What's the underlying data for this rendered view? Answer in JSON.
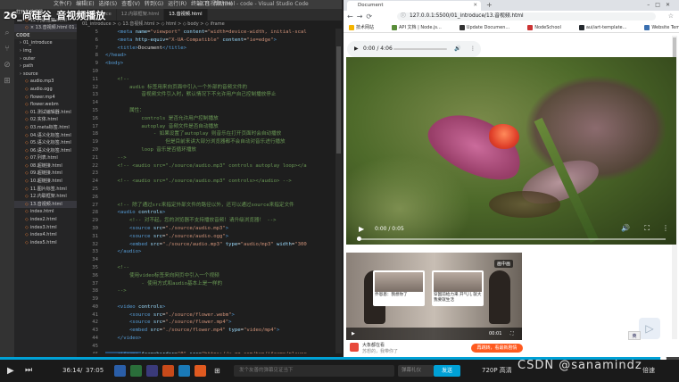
{
  "course_title": "26_尚硅谷_音视频播放",
  "vscode": {
    "title_menus": [
      "文件(F)",
      "编辑(E)",
      "选择(S)",
      "查看(V)",
      "转到(G)",
      "运行(R)",
      "终端(T)",
      "帮助(H)"
    ],
    "window_title": "13.音视频.html - code - Visual Studio Code",
    "activity_icons": [
      "files-icon",
      "search-icon",
      "git-icon",
      "debug-icon",
      "extensions-icon"
    ],
    "explorer": [
      {
        "label": "打开的编辑器",
        "type": "section"
      },
      {
        "label": "12.内联框架.html",
        "type": "file"
      },
      {
        "label": "× 13.音视频.html 01...",
        "type": "file",
        "selected": true
      },
      {
        "label": "CODE",
        "type": "section"
      },
      {
        "label": "01_introduce",
        "type": "folder"
      },
      {
        "label": "img",
        "type": "folder"
      },
      {
        "label": "outer",
        "type": "folder"
      },
      {
        "label": "path",
        "type": "folder"
      },
      {
        "label": "source",
        "type": "folder"
      },
      {
        "label": "audio.mp3",
        "type": "file"
      },
      {
        "label": "audio.ogg",
        "type": "file"
      },
      {
        "label": "flower.mp4",
        "type": "file"
      },
      {
        "label": "flower.webm",
        "type": "file"
      },
      {
        "label": "01.测试编辑器.html",
        "type": "file"
      },
      {
        "label": "02.实体.html",
        "type": "file"
      },
      {
        "label": "03.meta标签.html",
        "type": "file"
      },
      {
        "label": "04.语义化标签.html",
        "type": "file"
      },
      {
        "label": "05.语义化标签.html",
        "type": "file"
      },
      {
        "label": "06.语义化标签.html",
        "type": "file"
      },
      {
        "label": "07.列表.html",
        "type": "file"
      },
      {
        "label": "08.超链接.html",
        "type": "file"
      },
      {
        "label": "09.超链接.html",
        "type": "file"
      },
      {
        "label": "10.超链接.html",
        "type": "file"
      },
      {
        "label": "11.图片标签.html",
        "type": "file"
      },
      {
        "label": "12.内联框架.html",
        "type": "file"
      },
      {
        "label": "13.音视频.html",
        "type": "file",
        "selected": true
      },
      {
        "label": "index.html",
        "type": "file"
      },
      {
        "label": "index2.html",
        "type": "file"
      },
      {
        "label": "index3.html",
        "type": "file"
      },
      {
        "label": "index4.html",
        "type": "file"
      },
      {
        "label": "index5.html",
        "type": "file"
      }
    ],
    "tabs": [
      "01_introduce",
      "12.内联框架.html",
      "13.音视频.html"
    ],
    "breadcrumb": "01_introduce > ◇ 13.音视频.html > ◇ html > ◇ body > ◇ iframe",
    "lines": [
      {
        "n": "5",
        "seg": [
          [
            "tag",
            "    <meta "
          ],
          [
            "attr",
            "name"
          ],
          [
            "txt",
            "="
          ],
          [
            "str",
            "\"viewport\""
          ],
          [
            "txt",
            " "
          ],
          [
            "attr",
            "content"
          ],
          [
            "txt",
            "="
          ],
          [
            "str",
            "\"width=device-width, initial-scal"
          ]
        ]
      },
      {
        "n": "6",
        "seg": [
          [
            "tag",
            "    <meta "
          ],
          [
            "attr",
            "http-equiv"
          ],
          [
            "txt",
            "="
          ],
          [
            "str",
            "\"X-UA-Compatible\""
          ],
          [
            "txt",
            " "
          ],
          [
            "attr",
            "content"
          ],
          [
            "txt",
            "="
          ],
          [
            "str",
            "\"ie=edge\""
          ],
          [
            "tag",
            ">"
          ]
        ]
      },
      {
        "n": "7",
        "seg": [
          [
            "tag",
            "    <title>"
          ],
          [
            "txt",
            "Document"
          ],
          [
            "tag",
            "</title>"
          ]
        ]
      },
      {
        "n": "8",
        "seg": [
          [
            "tag",
            "</head>"
          ]
        ]
      },
      {
        "n": "9",
        "seg": [
          [
            "tag",
            "<body>"
          ]
        ]
      },
      {
        "n": "10",
        "seg": [
          [
            "txt",
            ""
          ]
        ]
      },
      {
        "n": "11",
        "seg": [
          [
            "com",
            "    <!--"
          ]
        ]
      },
      {
        "n": "12",
        "seg": [
          [
            "com",
            "        audio 标签用来向页面中引入一个外部的音频文件的"
          ]
        ]
      },
      {
        "n": "13",
        "seg": [
          [
            "com",
            "            音视频文件引入时，默认情况下不允许用户自己控制播放停止"
          ]
        ]
      },
      {
        "n": "14",
        "seg": [
          [
            "txt",
            ""
          ]
        ]
      },
      {
        "n": "15",
        "seg": [
          [
            "com",
            "        属性："
          ]
        ]
      },
      {
        "n": "16",
        "seg": [
          [
            "com",
            "            controls 是否允许用户控制播放"
          ]
        ]
      },
      {
        "n": "17",
        "seg": [
          [
            "com",
            "            autoplay 音频文件是否自动播放"
          ]
        ]
      },
      {
        "n": "18",
        "seg": [
          [
            "com",
            "                - 如果设置了autoplay 则音乐在打开页面时会自动播放"
          ]
        ]
      },
      {
        "n": "19",
        "seg": [
          [
            "com",
            "                    但是目前来讲大部分浏览器都不会自动对音乐进行播放"
          ]
        ]
      },
      {
        "n": "20",
        "seg": [
          [
            "com",
            "            loop 音乐是否循环播放"
          ]
        ]
      },
      {
        "n": "21",
        "seg": [
          [
            "com",
            "    -->"
          ]
        ]
      },
      {
        "n": "22",
        "seg": [
          [
            "com",
            "    <!-- <audio src=\"./source/audio.mp3\" controls autoplay loop></a"
          ]
        ]
      },
      {
        "n": "23",
        "seg": [
          [
            "txt",
            ""
          ]
        ]
      },
      {
        "n": "24",
        "seg": [
          [
            "com",
            "    <!-- <audio src=\"./source/audio.mp3\" controls></audio> -->"
          ]
        ]
      },
      {
        "n": "25",
        "seg": [
          [
            "txt",
            ""
          ]
        ]
      },
      {
        "n": "26",
        "seg": [
          [
            "txt",
            ""
          ]
        ]
      },
      {
        "n": "27",
        "seg": [
          [
            "com",
            "    <!-- 除了通过src来指定外部文件的路径以外，还可以通过source来指定文件"
          ]
        ]
      },
      {
        "n": "28",
        "seg": [
          [
            "tag",
            "    <audio "
          ],
          [
            "attr",
            "controls"
          ],
          [
            "tag",
            ">"
          ]
        ]
      },
      {
        "n": "29",
        "seg": [
          [
            "com",
            "        <!-- 对不起，您的浏览器不支持播放音频！请升级浏览器！ -->"
          ]
        ]
      },
      {
        "n": "30",
        "seg": [
          [
            "tag",
            "        <source "
          ],
          [
            "attr",
            "src"
          ],
          [
            "txt",
            "="
          ],
          [
            "str",
            "\"./source/audio.mp3\""
          ],
          [
            "tag",
            ">"
          ]
        ]
      },
      {
        "n": "31",
        "seg": [
          [
            "tag",
            "        <source "
          ],
          [
            "attr",
            "src"
          ],
          [
            "txt",
            "="
          ],
          [
            "str",
            "\"./source/audio.ogg\""
          ],
          [
            "tag",
            ">"
          ]
        ]
      },
      {
        "n": "32",
        "seg": [
          [
            "tag",
            "        <embed "
          ],
          [
            "attr",
            "src"
          ],
          [
            "txt",
            "="
          ],
          [
            "str",
            "\"./source/audio.mp3\""
          ],
          [
            "txt",
            " "
          ],
          [
            "attr",
            "type"
          ],
          [
            "txt",
            "="
          ],
          [
            "str",
            "\"audio/mp3\""
          ],
          [
            "txt",
            " "
          ],
          [
            "attr",
            "width"
          ],
          [
            "txt",
            "="
          ],
          [
            "str",
            "\"300"
          ]
        ]
      },
      {
        "n": "33",
        "seg": [
          [
            "tag",
            "    </audio>"
          ]
        ]
      },
      {
        "n": "34",
        "seg": [
          [
            "txt",
            ""
          ]
        ]
      },
      {
        "n": "35",
        "seg": [
          [
            "com",
            "    <!--"
          ]
        ]
      },
      {
        "n": "36",
        "seg": [
          [
            "com",
            "        使用video标签来向网页中引入一个视频"
          ]
        ]
      },
      {
        "n": "37",
        "seg": [
          [
            "com",
            "            - 使用方式和audio基本上是一样的"
          ]
        ]
      },
      {
        "n": "38",
        "seg": [
          [
            "com",
            "    -->"
          ]
        ]
      },
      {
        "n": "39",
        "seg": [
          [
            "txt",
            ""
          ]
        ]
      },
      {
        "n": "40",
        "seg": [
          [
            "tag",
            "    <video "
          ],
          [
            "attr",
            "controls"
          ],
          [
            "tag",
            ">"
          ]
        ]
      },
      {
        "n": "41",
        "seg": [
          [
            "tag",
            "        <source "
          ],
          [
            "attr",
            "src"
          ],
          [
            "txt",
            "="
          ],
          [
            "str",
            "\"./source/flower.webm\""
          ],
          [
            "tag",
            ">"
          ]
        ]
      },
      {
        "n": "42",
        "seg": [
          [
            "tag",
            "        <source "
          ],
          [
            "attr",
            "src"
          ],
          [
            "txt",
            "="
          ],
          [
            "str",
            "\"./source/flower.mp4\""
          ],
          [
            "tag",
            ">"
          ]
        ]
      },
      {
        "n": "43",
        "seg": [
          [
            "tag",
            "        <embed "
          ],
          [
            "attr",
            "src"
          ],
          [
            "txt",
            "="
          ],
          [
            "str",
            "\"./source/flower.mp4\""
          ],
          [
            "txt",
            " "
          ],
          [
            "attr",
            "type"
          ],
          [
            "txt",
            "="
          ],
          [
            "str",
            "\"video/mp4\""
          ],
          [
            "tag",
            ">"
          ]
        ]
      },
      {
        "n": "44",
        "seg": [
          [
            "tag",
            "    </video>"
          ]
        ]
      },
      {
        "n": "45",
        "seg": [
          [
            "txt",
            ""
          ]
        ]
      },
      {
        "n": "46",
        "seg": [
          [
            "tag",
            "    <iframe "
          ],
          [
            "attr",
            "frameborder"
          ],
          [
            "txt",
            "="
          ],
          [
            "str",
            "\"0\""
          ],
          [
            "txt",
            " "
          ],
          [
            "attr",
            "src"
          ],
          [
            "txt",
            "="
          ],
          [
            "str",
            "\"https://v.qq.com/txp/iframe/player"
          ]
        ]
      },
      {
        "n": "47",
        "seg": [
          [
            "tag",
            "</body>"
          ]
        ]
      }
    ],
    "status_items": [
      "行 46，列 13 (已选择 6)",
      "空格: 4",
      "UTF-8",
      "CRLF",
      "HTML",
      "Port : 5500",
      "☺",
      "🔔"
    ]
  },
  "browser": {
    "tab_title": "Document",
    "url": "127.0.0.1:5500/01_introduce/13.音视频.html",
    "bookmarks": [
      {
        "label": "技术网站",
        "color": "#f5b400"
      },
      {
        "label": "API 文档 | Node.js...",
        "color": "#5a8e3a"
      },
      {
        "label": "Update Documen...",
        "color": "#333333"
      },
      {
        "label": "NodeSchool",
        "color": "#cc3333"
      },
      {
        "label": "aui/art-template...",
        "color": "#24292e"
      },
      {
        "label": "Website Template...",
        "color": "#3a6fb0"
      }
    ],
    "audio": {
      "play": "▶",
      "time": "0:00 / 4:06",
      "volume_icon": "🔊",
      "more_icon": "⋮"
    },
    "video": {
      "time": "0:00 / 0:05",
      "progress": 0
    },
    "iframe": {
      "pip": "画中画",
      "card1": "乔恩恩：我想你了",
      "card2": "穿国前给力来 开气儿 就大我要就生活",
      "time": "00:01"
    },
    "ad": {
      "title": "大象都在看",
      "sub": "苏想的，我带你了",
      "button": "再跳转，看最新剧情"
    },
    "ime": "英"
  },
  "player": {
    "current": "36:14",
    "total": "37:05",
    "progress": 0.977,
    "danmu_placeholder": "发个友善的弹幕见证当下",
    "danmu_label": "弹幕礼仪",
    "send": "发送",
    "quality": "720P 高清",
    "speed": "倍速"
  },
  "watermark": "CSDN @sanamindz"
}
